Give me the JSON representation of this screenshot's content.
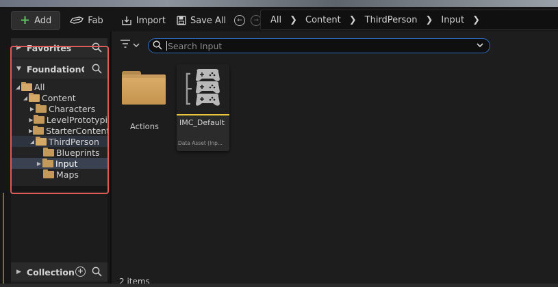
{
  "toolbar": {
    "add_label": "Add",
    "fab_label": "Fab",
    "import_label": "Import",
    "save_all_label": "Save All"
  },
  "breadcrumb": [
    "All",
    "Content",
    "ThirdPerson",
    "Input"
  ],
  "left_panel": {
    "favorites_label": "Favorites",
    "project_label": "FoundationCou",
    "tree": [
      {
        "label": "All"
      },
      {
        "label": "Content"
      },
      {
        "label": "Characters"
      },
      {
        "label": "LevelPrototypi"
      },
      {
        "label": "StarterContent"
      },
      {
        "label": "ThirdPerson"
      },
      {
        "label": "Blueprints"
      },
      {
        "label": "Input",
        "selected": true
      },
      {
        "label": "Maps"
      }
    ],
    "collection_label": "Collection"
  },
  "search": {
    "placeholder": "Search Input"
  },
  "assets": [
    {
      "name": "Actions",
      "kind": "folder"
    },
    {
      "name": "IMC_Default",
      "type": "Data Asset (Inp..."
    }
  ],
  "status": {
    "item_count": "2 items"
  },
  "colors": {
    "accent_blue": "#2f6fc7",
    "highlight_red": "#e05a5a",
    "folder": "#c49a5a",
    "asset_bar": "#e8c53a"
  }
}
